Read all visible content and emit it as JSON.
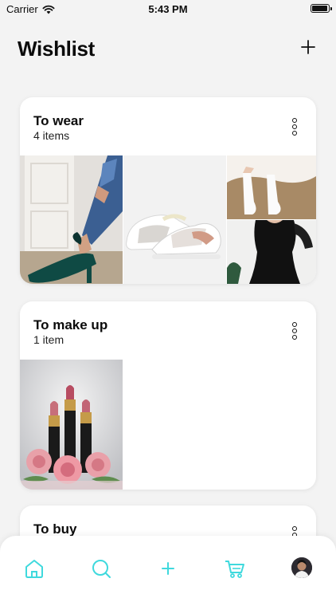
{
  "status_bar": {
    "carrier": "Carrier",
    "time": "5:43 PM"
  },
  "header": {
    "title": "Wishlist"
  },
  "lists": [
    {
      "title": "To wear",
      "count": "4 items"
    },
    {
      "title": "To make up",
      "count": "1 item"
    },
    {
      "title": "To buy"
    }
  ],
  "tab_bar": {
    "accent": "#3fd9dd",
    "icons": [
      "home-icon",
      "search-icon",
      "plus-icon",
      "cart-icon",
      "avatar"
    ]
  }
}
